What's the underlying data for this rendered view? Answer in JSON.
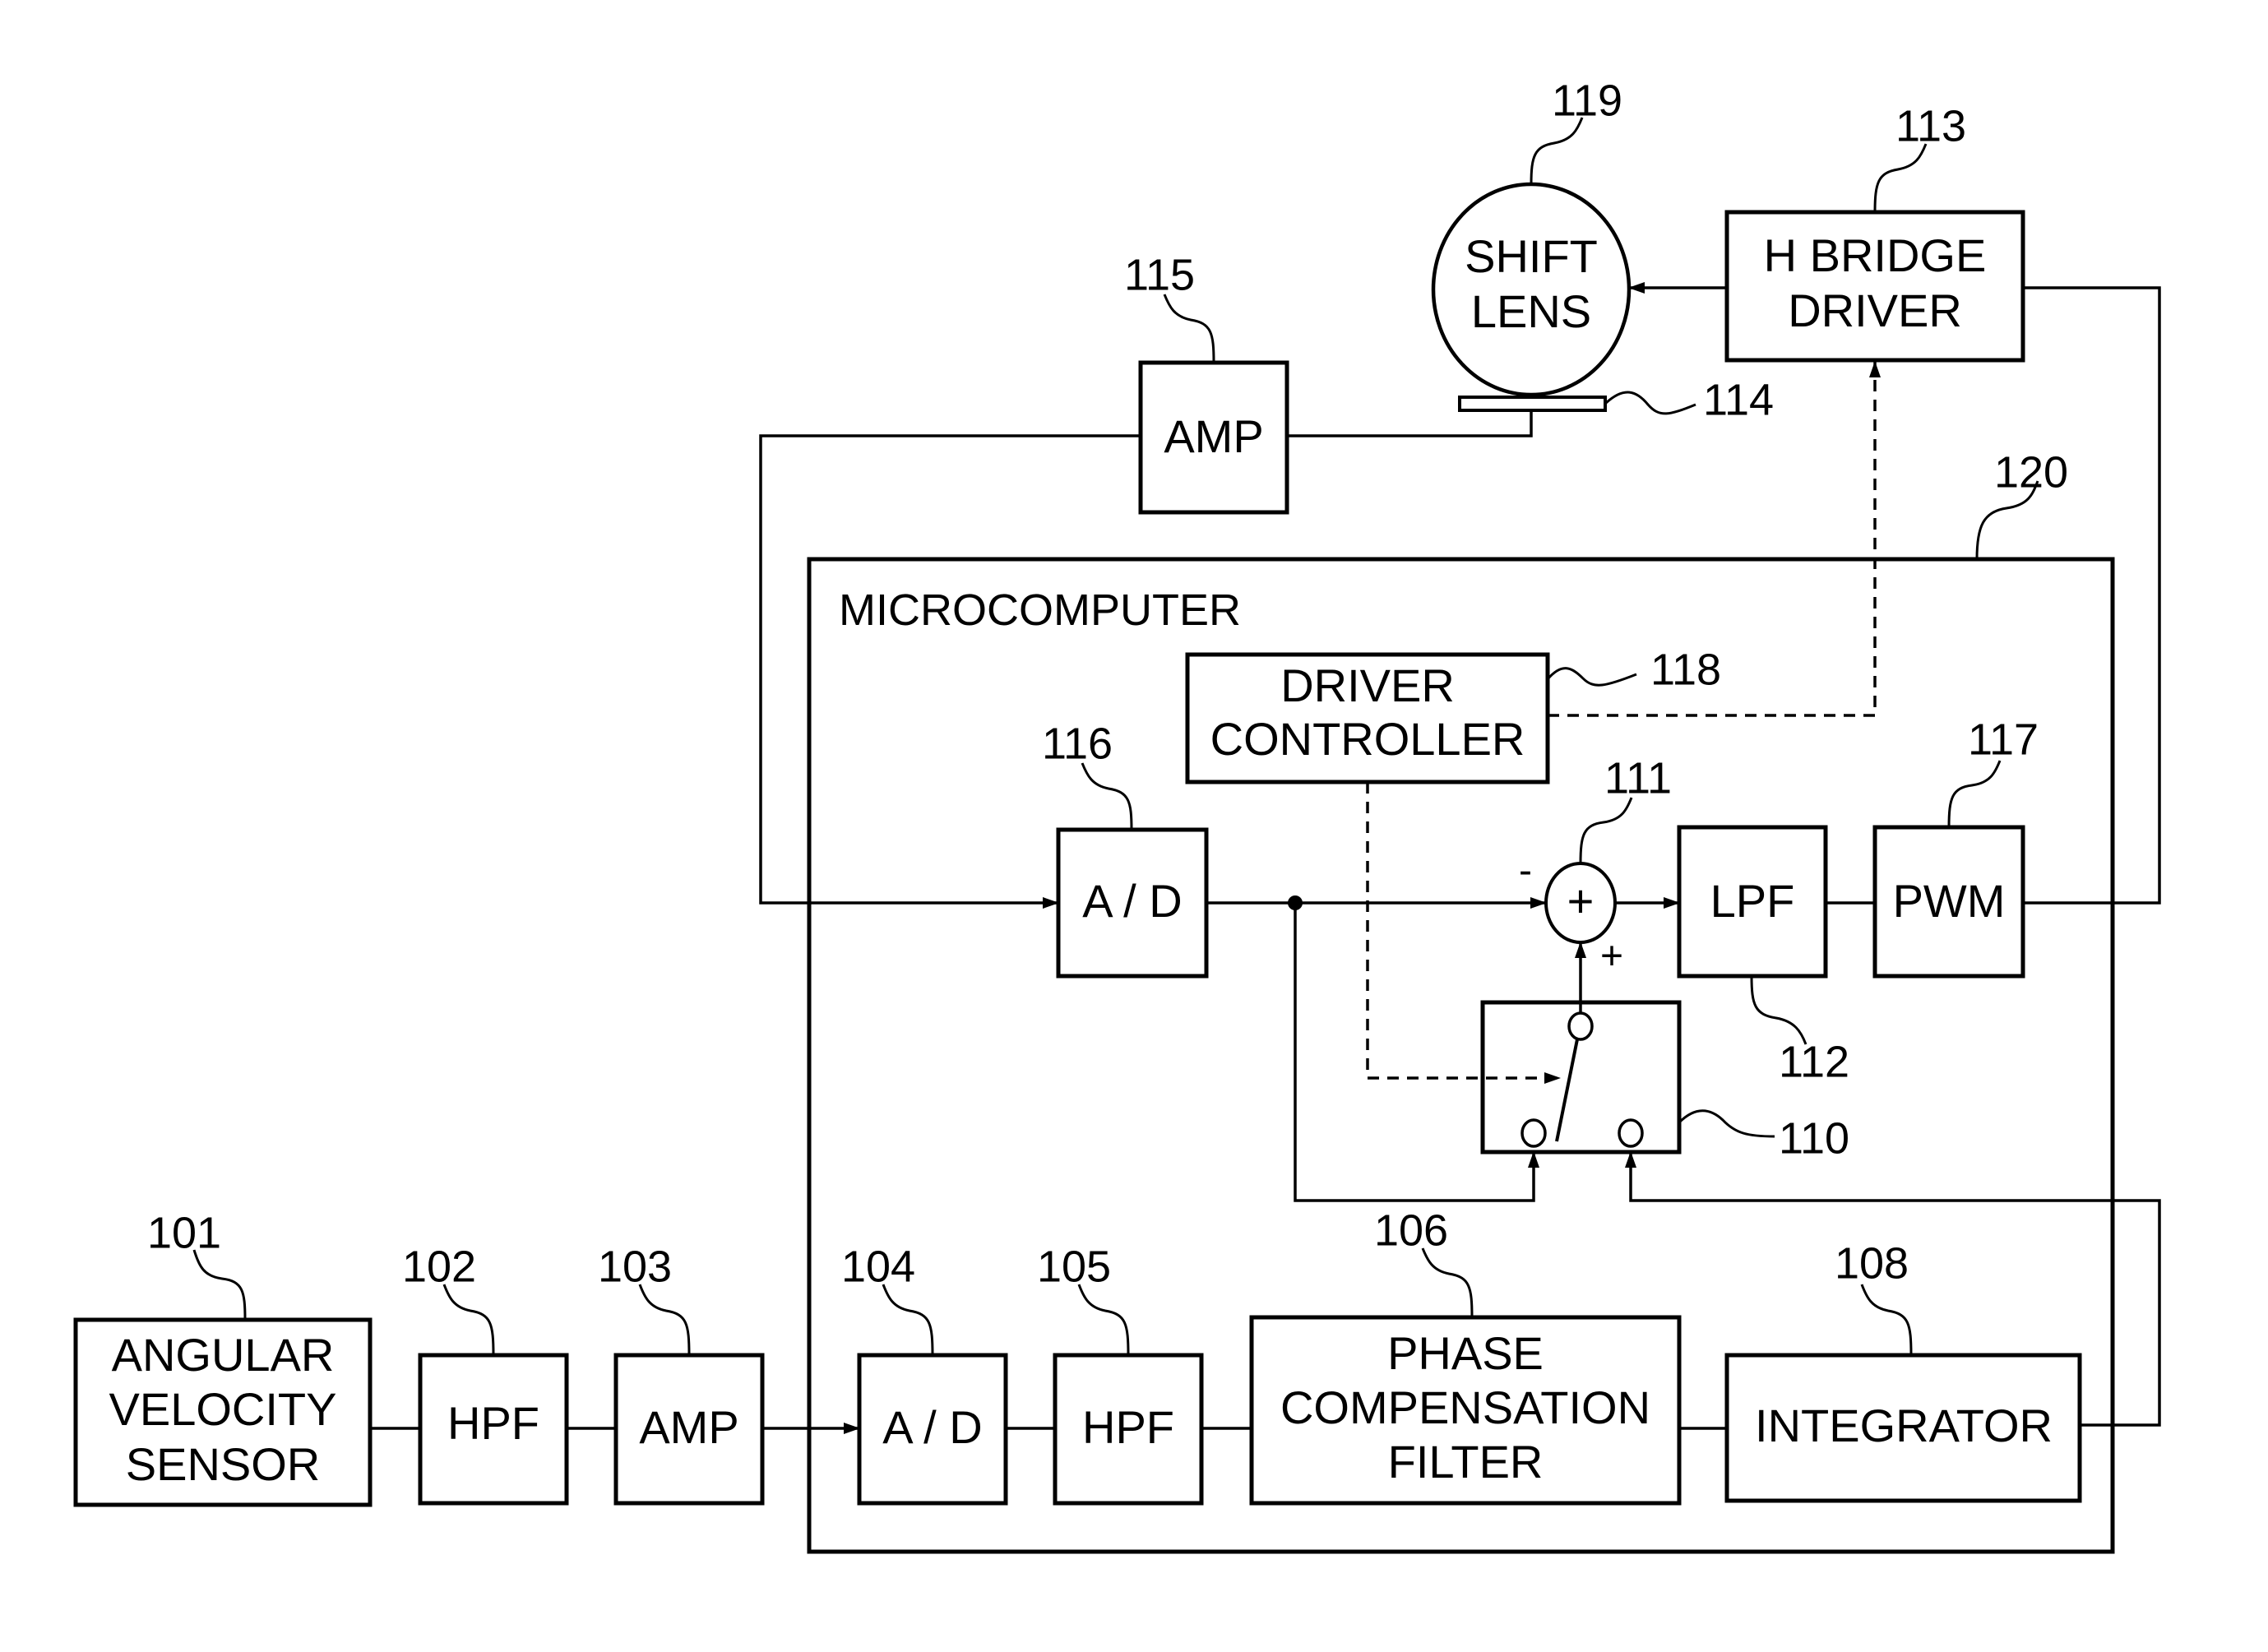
{
  "diagram": {
    "type": "block-diagram",
    "subject": "image stabilization shift-lens control system",
    "microcomputer": {
      "label": "MICROCOMPUTER",
      "ref": "120"
    },
    "blocks": {
      "angular_velocity_sensor": {
        "lines": [
          "ANGULAR",
          "VELOCITY",
          "SENSOR"
        ],
        "ref": "101"
      },
      "hpf_102": {
        "lines": [
          "HPF"
        ],
        "ref": "102"
      },
      "amp_103": {
        "lines": [
          "AMP"
        ],
        "ref": "103"
      },
      "ad_104": {
        "lines": [
          "A / D"
        ],
        "ref": "104"
      },
      "hpf_105": {
        "lines": [
          "HPF"
        ],
        "ref": "105"
      },
      "phase_comp_106": {
        "lines": [
          "PHASE",
          "COMPENSATION",
          "FILTER"
        ],
        "ref": "106"
      },
      "integrator_108": {
        "lines": [
          "INTEGRATOR"
        ],
        "ref": "108"
      },
      "switch_110": {
        "ref": "110"
      },
      "adder_111": {
        "symbol": "+",
        "ref": "111",
        "minus_sign": "-",
        "plus_sign": "+"
      },
      "lpf_112": {
        "lines": [
          "LPF"
        ],
        "ref": "112"
      },
      "h_bridge_113": {
        "lines": [
          "H BRIDGE",
          "DRIVER"
        ],
        "ref": "113"
      },
      "position_sensor_114": {
        "ref": "114"
      },
      "amp_115": {
        "lines": [
          "AMP"
        ],
        "ref": "115"
      },
      "ad_116": {
        "lines": [
          "A / D"
        ],
        "ref": "116"
      },
      "pwm_117": {
        "lines": [
          "PWM"
        ],
        "ref": "117"
      },
      "driver_controller_118": {
        "lines": [
          "DRIVER",
          "CONTROLLER"
        ],
        "ref": "118"
      },
      "shift_lens_119": {
        "lines": [
          "SHIFT",
          "LENS"
        ],
        "ref": "119"
      }
    },
    "connections": [
      {
        "from": "101",
        "to": "102",
        "style": "solid"
      },
      {
        "from": "102",
        "to": "103",
        "style": "solid"
      },
      {
        "from": "103",
        "to": "104",
        "style": "arrow"
      },
      {
        "from": "104",
        "to": "105",
        "style": "solid"
      },
      {
        "from": "105",
        "to": "106",
        "style": "solid"
      },
      {
        "from": "106",
        "to": "108",
        "style": "solid"
      },
      {
        "from": "108",
        "to": "110",
        "style": "arrow",
        "port": "right-input"
      },
      {
        "from": "116",
        "to": "110",
        "style": "arrow",
        "port": "left-input"
      },
      {
        "from": "116",
        "to": "111",
        "style": "arrow",
        "sign": "-"
      },
      {
        "from": "110",
        "to": "111",
        "style": "arrow",
        "sign": "+"
      },
      {
        "from": "111",
        "to": "112",
        "style": "arrow"
      },
      {
        "from": "112",
        "to": "117",
        "style": "solid"
      },
      {
        "from": "117",
        "to": "113",
        "style": "solid"
      },
      {
        "from": "113",
        "to": "119",
        "style": "arrow"
      },
      {
        "from": "114",
        "to": "115",
        "style": "solid"
      },
      {
        "from": "115",
        "to": "116",
        "style": "arrow"
      },
      {
        "from": "118",
        "to": "113",
        "style": "dashed-arrow"
      },
      {
        "from": "118",
        "to": "110",
        "style": "dashed-arrow"
      }
    ]
  }
}
